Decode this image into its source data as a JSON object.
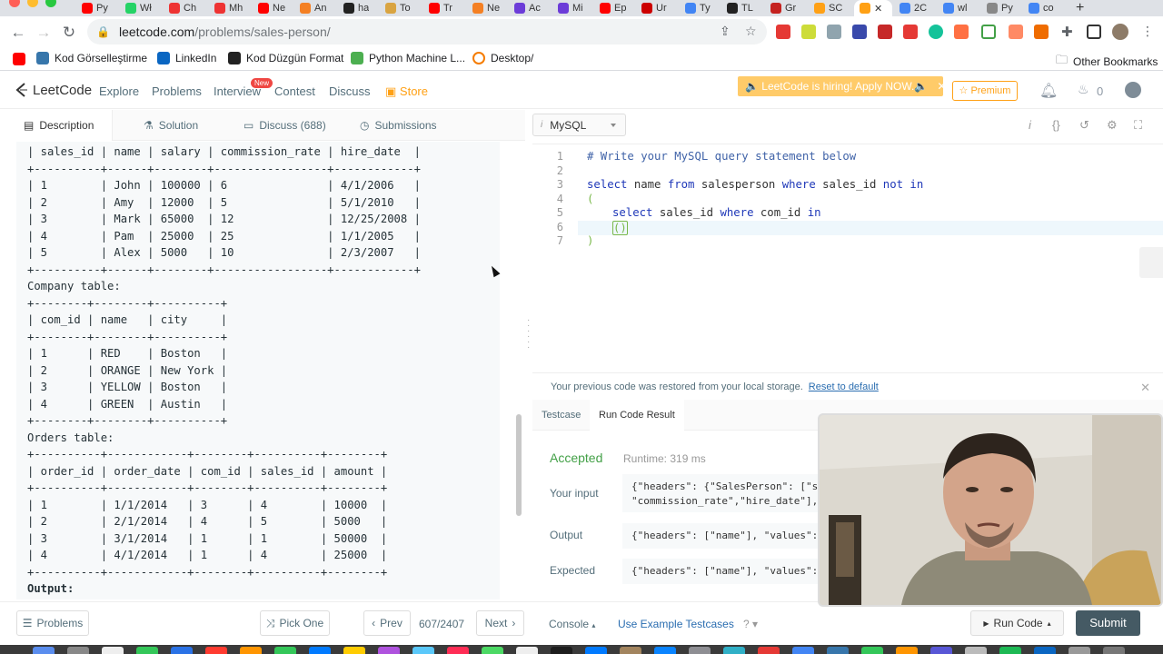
{
  "browser": {
    "tabs": [
      "Py",
      "Wł",
      "Ch",
      "Mh",
      "Ne",
      "An",
      "ha",
      "To",
      "Tr",
      "Ne",
      "Ac",
      "Mi",
      "Ep",
      "Ur",
      "Ty",
      "TL",
      "Gr",
      "SC",
      "",
      "2C",
      "wl",
      "Py",
      "co"
    ],
    "url_host": "leetcode.com",
    "url_path": "/problems/sales-person/",
    "bookmarks": [
      "Kod Görselleştirme",
      "LinkedIn",
      "Kod Düzgün Format",
      "Python Machine L...",
      "Desktop/"
    ],
    "other_bookmarks": "Other Bookmarks"
  },
  "nav": {
    "logo": "LeetCode",
    "links": [
      "Explore",
      "Problems",
      "Interview",
      "Contest",
      "Discuss",
      "Store"
    ],
    "new_badge": "New",
    "hiring": "🔈 LeetCode is hiring! Apply NOW.🔈",
    "premium": "☆ Premium",
    "fire_count": "0"
  },
  "left_tabs": [
    "Description",
    "Solution",
    "Discuss (688)",
    "Submissions"
  ],
  "description_lines": [
    "| sales_id | name | salary | commission_rate | hire_date  |",
    "+----------+------+--------+-----------------+------------+",
    "| 1        | John | 100000 | 6               | 4/1/2006   |",
    "| 2        | Amy  | 12000  | 5               | 5/1/2010   |",
    "| 3        | Mark | 65000  | 12              | 12/25/2008 |",
    "| 4        | Pam  | 25000  | 25              | 1/1/2005   |",
    "| 5        | Alex | 5000   | 10              | 2/3/2007   |",
    "+----------+------+--------+-----------------+------------+",
    "Company table:",
    "+--------+--------+----------+",
    "| com_id | name   | city     |",
    "+--------+--------+----------+",
    "| 1      | RED    | Boston   |",
    "| 2      | ORANGE | New York |",
    "| 3      | YELLOW | Boston   |",
    "| 4      | GREEN  | Austin   |",
    "+--------+--------+----------+",
    "Orders table:",
    "+----------+------------+--------+----------+--------+",
    "| order_id | order_date | com_id | sales_id | amount |",
    "+----------+------------+--------+----------+--------+",
    "| 1        | 1/1/2014   | 3      | 4        | 10000  |",
    "| 2        | 2/1/2014   | 4      | 5        | 5000   |",
    "| 3        | 3/1/2014   | 1      | 1        | 50000  |",
    "| 4        | 4/1/2014   | 1      | 4        | 25000  |",
    "+----------+------------+--------+----------+--------+"
  ],
  "output_label": "Output:",
  "editor": {
    "language": "MySQL",
    "line_numbers": [
      "1",
      "2",
      "3",
      "4",
      "5",
      "6",
      "7"
    ],
    "comment": "# Write your MySQL query statement below",
    "line3": {
      "k1": "select",
      "t1": " name ",
      "k2": "from",
      "t2": " salesperson ",
      "k3": "where",
      "t3": " sales_id ",
      "k4": "not",
      "k5": "in"
    },
    "line4": "(",
    "line5": {
      "k1": "select",
      "t1": " sales_id ",
      "k2": "where",
      "t2": " com_id ",
      "k3": "in"
    },
    "line6": "()",
    "line7": ")"
  },
  "restore": {
    "message": "Your previous code was restored from your local storage.",
    "link": "Reset to default"
  },
  "result_tabs": [
    "Testcase",
    "Run Code Result"
  ],
  "result": {
    "status": "Accepted",
    "runtime": "Runtime: 319 ms",
    "your_input_label": "Your input",
    "your_input_value": "{\"headers\": {\"SalesPerson\": [\"sa\n\"commission_rate\",\"hire_date\"],",
    "output_label": "Output",
    "output_value": "{\"headers\": [\"name\"], \"values\":",
    "expected_label": "Expected",
    "expected_value": "{\"headers\": [\"name\"], \"values\":"
  },
  "bottom": {
    "problems": "Problems",
    "pick_one": "Pick One",
    "prev": "Prev",
    "progress": "607/2407",
    "next": "Next",
    "console": "Console",
    "use_example": "Use Example Testcases",
    "run_code": "Run Code",
    "submit": "Submit"
  },
  "colors": {
    "accent": "#ffa116",
    "accepted": "#43a047",
    "submit_bg": "#455a64",
    "keyword": "#1e37b8"
  }
}
